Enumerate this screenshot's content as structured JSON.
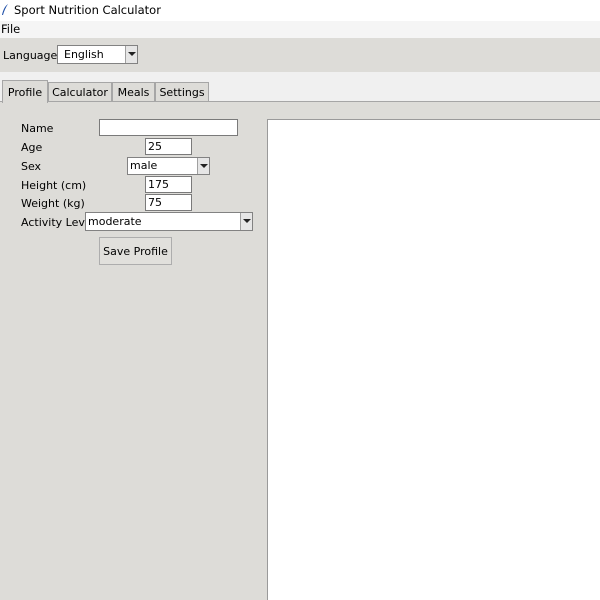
{
  "window": {
    "title": "Sport Nutrition Calculator"
  },
  "menu": {
    "file": "File"
  },
  "toolbar": {
    "language_label": "Language",
    "language_value": "English"
  },
  "tabs": [
    {
      "label": "Profile"
    },
    {
      "label": "Calculator"
    },
    {
      "label": "Meals"
    },
    {
      "label": "Settings"
    }
  ],
  "profile": {
    "name_label": "Name",
    "name_value": "",
    "age_label": "Age",
    "age_value": "25",
    "sex_label": "Sex",
    "sex_value": "male",
    "height_label": "Height (cm)",
    "height_value": "175",
    "weight_label": "Weight (kg)",
    "weight_value": "75",
    "activity_label": "Activity Level",
    "activity_value": "moderate",
    "save_label": "Save Profile"
  }
}
